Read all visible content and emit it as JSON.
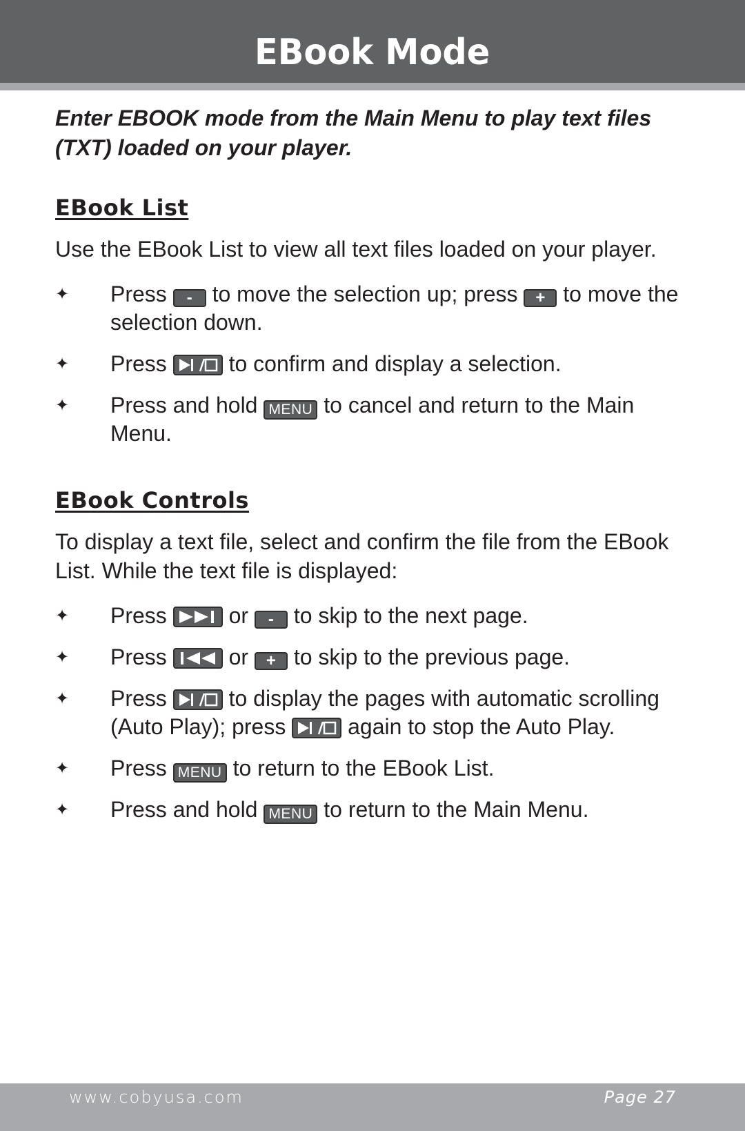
{
  "header": {
    "title": "EBook Mode"
  },
  "intro": "Enter EBOOK mode from the Main Menu to play text files (TXT) loaded on your player.",
  "sections": [
    {
      "heading": "EBook List",
      "paragraph": "Use the EBook List to view all text files loaded on your player.",
      "bullets": [
        {
          "parts": [
            "Press",
            "to move the selection up; press",
            "to move the selection down."
          ],
          "buttons": [
            "minus",
            "plus"
          ]
        },
        {
          "parts": [
            "Press",
            "to confirm and display a selection."
          ],
          "buttons": [
            "play-pause"
          ]
        },
        {
          "parts": [
            "Press and hold",
            "to cancel and return to the Main Menu."
          ],
          "buttons": [
            "menu"
          ]
        }
      ]
    },
    {
      "heading": "EBook Controls",
      "paragraph": "To display a text file, select and confirm the file from the EBook List. While the text file is displayed:",
      "bullets": [
        {
          "parts": [
            "Press",
            "or",
            "to skip to the next page."
          ],
          "buttons": [
            "next",
            "minus"
          ]
        },
        {
          "parts": [
            "Press",
            "or",
            "to skip to the previous page."
          ],
          "buttons": [
            "previous",
            "plus"
          ]
        },
        {
          "parts": [
            "Press",
            "to display the pages with automatic scrolling (Auto Play); press",
            "again to stop the Auto Play."
          ],
          "buttons": [
            "play-pause",
            "play-pause"
          ]
        },
        {
          "parts": [
            "Press",
            "to return to the EBook List."
          ],
          "buttons": [
            "menu"
          ]
        },
        {
          "parts": [
            "Press and hold",
            "to return to the Main Menu."
          ],
          "buttons": [
            "menu"
          ]
        }
      ]
    }
  ],
  "button_labels": {
    "minus": "-",
    "plus": "+",
    "menu": "MENU"
  },
  "bullet_glyph": "✦",
  "footer": {
    "url": "www.cobyusa.com",
    "page": "Page 27"
  },
  "colors": {
    "header_bg": "#616264",
    "strip": "#a6a8ab",
    "footer_bg": "#a7a9ac",
    "button_bg": "#5c5d5f"
  }
}
